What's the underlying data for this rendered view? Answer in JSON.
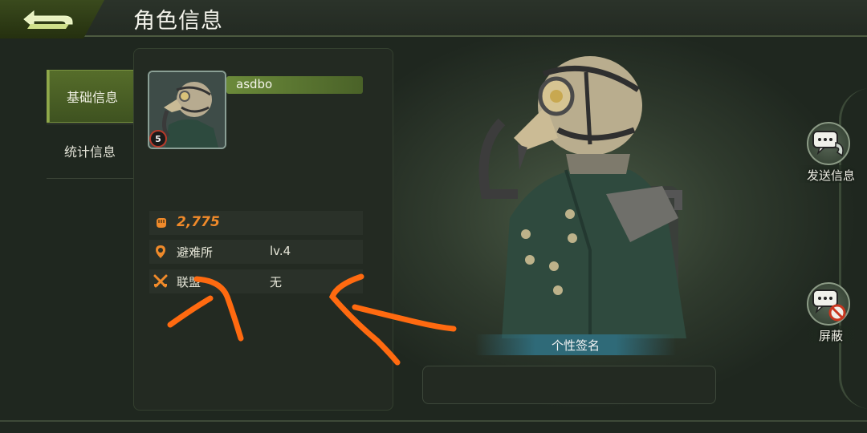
{
  "header": {
    "title": "角色信息",
    "back_icon": "back-arrow-icon"
  },
  "tabs": [
    {
      "label": "基础信息",
      "active": true
    },
    {
      "label": "统计信息",
      "active": false
    }
  ],
  "profile": {
    "name": "asdbo",
    "level": "5",
    "power": "2,775",
    "stats": [
      {
        "icon": "location-pin-icon",
        "label": "避难所",
        "value": "lv.4"
      },
      {
        "icon": "crossed-swords-icon",
        "label": "联盟",
        "value": "无"
      }
    ]
  },
  "signature": {
    "label": "个性签名",
    "value": ""
  },
  "side_buttons": {
    "send_message": "发送信息",
    "block": "屏蔽"
  },
  "colors": {
    "accent_green": "#566d2a",
    "power_orange": "#f08a2a",
    "annotation_orange": "#ff6a10",
    "signature_teal": "#2f6a78"
  }
}
